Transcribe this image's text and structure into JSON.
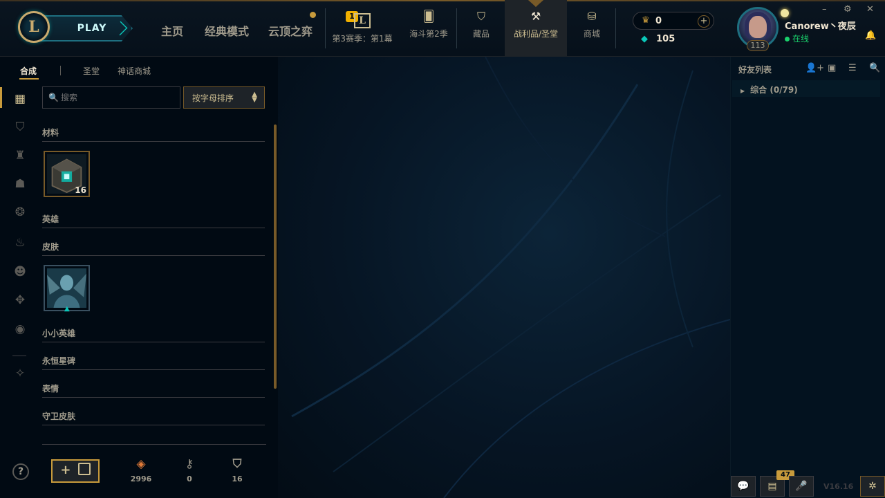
{
  "top_nav": {
    "play_label": "PLAY",
    "logo_letter": "L",
    "main_items": [
      {
        "label": "主页",
        "has_dot": false
      },
      {
        "label": "经典模式",
        "has_dot": false
      },
      {
        "label": "云顶之弈",
        "has_dot": true
      }
    ],
    "season": {
      "badge": "1",
      "icon_letter": "L",
      "label": "第3赛季：第1幕"
    },
    "icon_items": [
      {
        "label": "海斗第2季",
        "icon": "cards-icon"
      },
      {
        "label": "藏品",
        "icon": "collection-icon"
      },
      {
        "label": "战利品/圣堂",
        "icon": "loot-icon",
        "active": true
      },
      {
        "label": "商城",
        "icon": "store-icon"
      }
    ]
  },
  "currency": {
    "rp_value": "0",
    "rp_plus": "+",
    "be_value": "105"
  },
  "profile": {
    "username": "Canorew丶夜辰",
    "status": "在线",
    "level": "113"
  },
  "window_controls": {
    "minimize": "–",
    "settings": "⚙",
    "close": "✕"
  },
  "loot": {
    "subtabs": [
      "合成",
      "圣堂",
      "神话商城"
    ],
    "search_placeholder": "搜索",
    "sort_label": "按字母排序",
    "categories": [
      {
        "label": "材料"
      },
      {
        "label": "英雄"
      },
      {
        "label": "皮肤"
      },
      {
        "label": "小小英雄"
      },
      {
        "label": "永恒星碑"
      },
      {
        "label": "表情"
      },
      {
        "label": "守卫皮肤"
      }
    ],
    "material_tile": {
      "name": "hextech-chest",
      "count": "16"
    },
    "skin_tile": {
      "name": "skin-shard"
    },
    "add_chest_label": "+",
    "resources": [
      {
        "icon": "orange-essence-icon",
        "value": "2996"
      },
      {
        "icon": "key-icon",
        "value": "0"
      },
      {
        "icon": "chest-icon",
        "value": "16"
      }
    ]
  },
  "friends": {
    "header": "好友列表",
    "group_label": "综合 (0/79)",
    "chat_badge": "47",
    "version": "V16.16"
  },
  "colors": {
    "gold": "#c89b3c",
    "gold_light": "#cdbe91",
    "text": "#a09b8c",
    "text_bright": "#f0e6d2",
    "teal": "#0ac8b9",
    "online_green": "#1ad26c",
    "bg": "#010a13"
  }
}
